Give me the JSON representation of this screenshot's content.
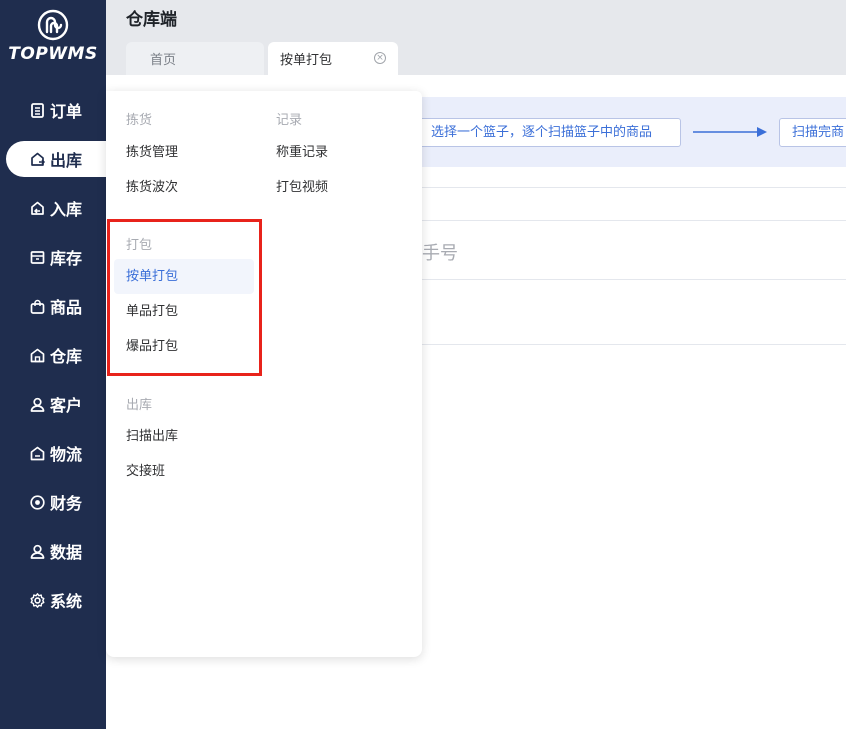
{
  "logo": {
    "text": "TOPWMS"
  },
  "sidebar": {
    "items": [
      {
        "label": "订单",
        "icon": "clipboard-icon"
      },
      {
        "label": "出库",
        "icon": "outbound-icon",
        "active": true
      },
      {
        "label": "入库",
        "icon": "inbound-icon"
      },
      {
        "label": "库存",
        "icon": "inventory-icon"
      },
      {
        "label": "商品",
        "icon": "shopping-bag-icon"
      },
      {
        "label": "仓库",
        "icon": "warehouse-icon"
      },
      {
        "label": "客户",
        "icon": "user-icon"
      },
      {
        "label": "物流",
        "icon": "logistics-icon"
      },
      {
        "label": "财务",
        "icon": "finance-icon"
      },
      {
        "label": "数据",
        "icon": "data-user-icon"
      },
      {
        "label": "系统",
        "icon": "gear-icon"
      }
    ]
  },
  "header": {
    "title": "仓库端",
    "tabs": [
      {
        "label": "首页"
      },
      {
        "label": "按单打包",
        "active": true
      }
    ]
  },
  "main": {
    "step1": "选择一个篮子，逐个扫描篮子中的商品",
    "step2": "扫描完商",
    "field_hint_fragment": "手号"
  },
  "menu": {
    "groups": [
      {
        "title": "拣货",
        "items": [
          "拣货管理",
          "拣货波次"
        ]
      },
      {
        "title": "记录",
        "items": [
          "称重记录",
          "打包视频"
        ]
      },
      {
        "title": "打包",
        "items": [
          "按单打包",
          "单品打包",
          "爆品打包"
        ],
        "selected": "按单打包"
      },
      {
        "title": "出库",
        "items": [
          "扫描出库",
          "交接班"
        ]
      }
    ]
  },
  "colors": {
    "sidebar_bg": "#1f2d4e",
    "accent": "#3b6fd8",
    "highlight": "#e8231b"
  }
}
